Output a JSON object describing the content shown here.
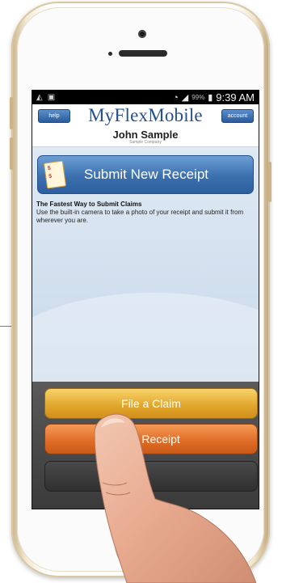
{
  "status_bar": {
    "left_icons": [
      "signal-icon",
      "notification-icon"
    ],
    "battery_percent": "99%",
    "time": "9:39 AM"
  },
  "header": {
    "help_label": "help",
    "account_label": "account",
    "logo_text": "MyFlexMobile",
    "user_name": "John Sample",
    "company": "Sample Company"
  },
  "main": {
    "submit_label": "Submit New Receipt",
    "fastest_title": "The Fastest Way to Submit Claims",
    "fastest_desc": "Use the built-in camera to take a photo of your receipt and submit it from wherever you are."
  },
  "actions": {
    "file_claim": "File a Claim",
    "card_receipt": "ard Receipt"
  },
  "colors": {
    "brand_blue": "#25508f",
    "file_claim": "#e0a52a",
    "card_receipt": "#de6a25"
  }
}
